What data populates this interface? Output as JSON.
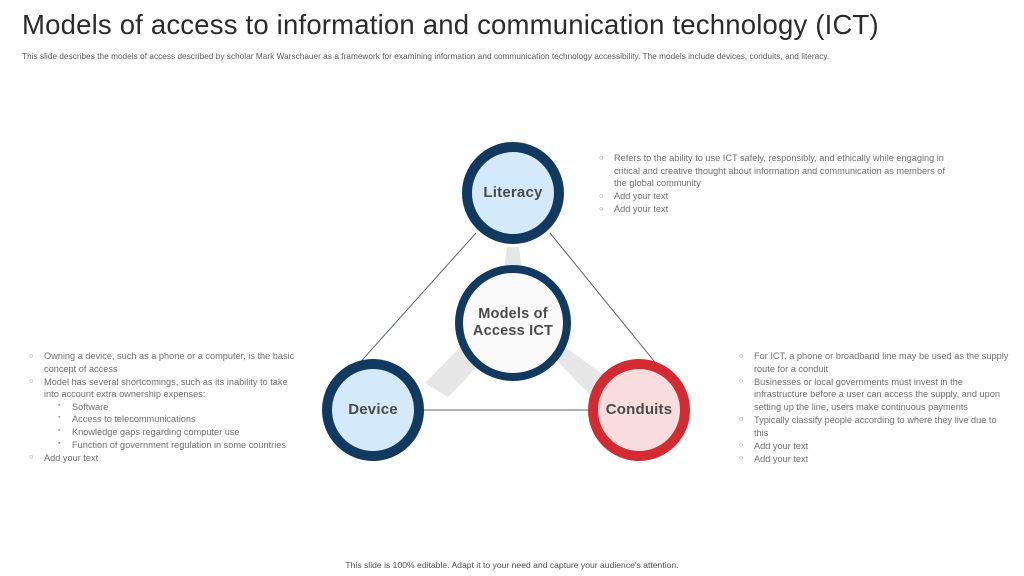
{
  "slide": {
    "title": "Models of access to information and communication technology (ICT)",
    "subtitle": "This slide describes the models of access described by scholar Mark Warschauer as a framework for examining information and communication technology accessibility. The models include devices, conduits, and literacy.",
    "footer": "This slide is 100% editable. Adapt it to your need and capture your audience's attention."
  },
  "colors": {
    "navy": "#123a60",
    "red": "#d42a31",
    "light_blue_fill": "#d4e9f9",
    "light_red_fill": "#f9dcde",
    "center_fill": "#fafafa",
    "band_gray": "#e6e6e6",
    "connector_line": "#5d6470",
    "title_text": "#2b2b2b",
    "body_text": "#6f6f6f"
  },
  "diagram": {
    "center": {
      "label_line1": "Models of",
      "label_line2": "Access ICT"
    },
    "nodes": [
      {
        "id": "literacy",
        "label": "Literacy"
      },
      {
        "id": "device",
        "label": "Device"
      },
      {
        "id": "conduits",
        "label": "Conduits"
      }
    ]
  },
  "bullets": {
    "literacy": [
      {
        "text": "Refers to the ability to use ICT safely, responsibly, and ethically while engaging in critical and creative thought about information and communication as members of the global community"
      },
      {
        "text": "Add your text"
      },
      {
        "text": "Add your text"
      }
    ],
    "device": [
      {
        "text": "Owning a device, such as a phone or a computer, is the basic concept of access"
      },
      {
        "text": "Model has several shortcomings, such as its inability to take into account extra ownership expenses:",
        "sub": [
          "Software",
          "Access to telecommunications",
          "Knowledge gaps regarding computer use",
          "Function of government regulation in some countries"
        ]
      },
      {
        "text": "Add your text"
      }
    ],
    "conduits": [
      {
        "text": "For ICT, a phone or broadband line may be used as the supply route for a conduit"
      },
      {
        "text": "Businesses or local governments must invest in the infrastructure before a user can access the supply, and upon setting up the line, users make continuous payments"
      },
      {
        "text": "Typically classify people according to where they live due to this"
      },
      {
        "text": "Add your text"
      },
      {
        "text": "Add your text"
      }
    ]
  }
}
